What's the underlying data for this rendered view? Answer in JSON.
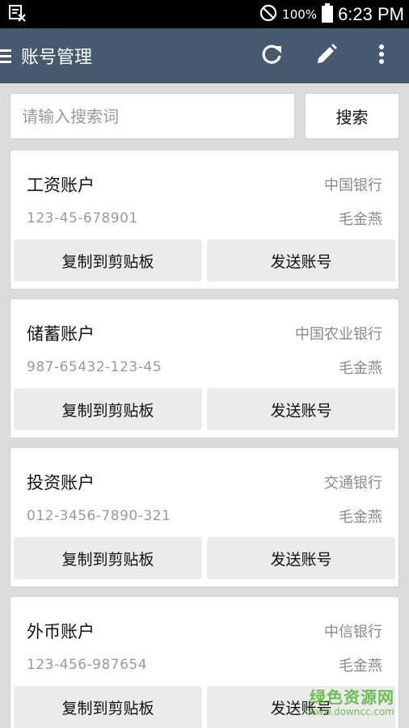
{
  "status_bar": {
    "battery_percent": "100%",
    "time": "6:23 PM"
  },
  "app_bar": {
    "title": "账号管理",
    "icons": [
      "menu-icon",
      "refresh-icon",
      "edit-icon",
      "more-vert-icon"
    ]
  },
  "search": {
    "placeholder": "请输入搜索词",
    "value": "",
    "button_label": "搜索"
  },
  "accounts": [
    {
      "name": "工资账户",
      "bank": "中国银行",
      "number": "123-45-678901",
      "owner": "毛金燕",
      "copy_label": "复制到剪贴板",
      "send_label": "发送账号"
    },
    {
      "name": "储蓄账户",
      "bank": "中国农业银行",
      "number": "987-65432-123-45",
      "owner": "毛金燕",
      "copy_label": "复制到剪贴板",
      "send_label": "发送账号"
    },
    {
      "name": "投资账户",
      "bank": "交通银行",
      "number": "012-3456-7890-321",
      "owner": "毛金燕",
      "copy_label": "复制到剪贴板",
      "send_label": "发送账号"
    },
    {
      "name": "外币账户",
      "bank": "中信银行",
      "number": "123-456-987654",
      "owner": "毛金燕",
      "copy_label": "复制到剪贴板",
      "send_label": "发送账号"
    }
  ],
  "watermark": {
    "main": "绿色资源网",
    "sub": "www.downcc.com"
  },
  "colors": {
    "app_bar": "#46596f",
    "background": "#dcdcdc",
    "card": "#ffffff",
    "card_button": "#ebebeb",
    "watermark": "#59b73c"
  }
}
